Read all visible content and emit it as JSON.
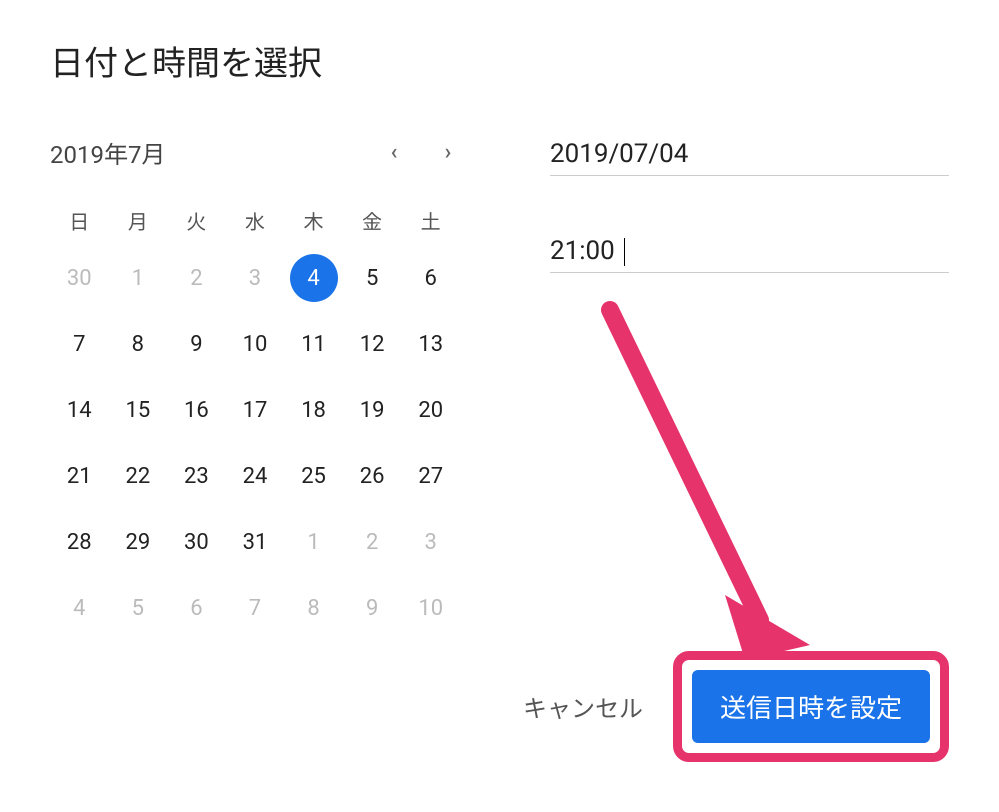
{
  "dialog": {
    "title": "日付と時間を選択"
  },
  "calendar": {
    "month_label": "2019年7月",
    "weekdays": [
      "日",
      "月",
      "火",
      "水",
      "木",
      "金",
      "土"
    ],
    "selected_day": 4,
    "weeks": [
      [
        {
          "n": 30,
          "o": true
        },
        {
          "n": 1,
          "o": true
        },
        {
          "n": 2,
          "o": true
        },
        {
          "n": 3,
          "o": true
        },
        {
          "n": 4,
          "o": false,
          "sel": true
        },
        {
          "n": 5,
          "o": false
        },
        {
          "n": 6,
          "o": false
        }
      ],
      [
        {
          "n": 7,
          "o": false
        },
        {
          "n": 8,
          "o": false
        },
        {
          "n": 9,
          "o": false
        },
        {
          "n": 10,
          "o": false
        },
        {
          "n": 11,
          "o": false
        },
        {
          "n": 12,
          "o": false
        },
        {
          "n": 13,
          "o": false
        }
      ],
      [
        {
          "n": 14,
          "o": false
        },
        {
          "n": 15,
          "o": false
        },
        {
          "n": 16,
          "o": false
        },
        {
          "n": 17,
          "o": false
        },
        {
          "n": 18,
          "o": false
        },
        {
          "n": 19,
          "o": false
        },
        {
          "n": 20,
          "o": false
        }
      ],
      [
        {
          "n": 21,
          "o": false
        },
        {
          "n": 22,
          "o": false
        },
        {
          "n": 23,
          "o": false
        },
        {
          "n": 24,
          "o": false
        },
        {
          "n": 25,
          "o": false
        },
        {
          "n": 26,
          "o": false
        },
        {
          "n": 27,
          "o": false
        }
      ],
      [
        {
          "n": 28,
          "o": false
        },
        {
          "n": 29,
          "o": false
        },
        {
          "n": 30,
          "o": false
        },
        {
          "n": 31,
          "o": false
        },
        {
          "n": 1,
          "o": true
        },
        {
          "n": 2,
          "o": true
        },
        {
          "n": 3,
          "o": true
        }
      ],
      [
        {
          "n": 4,
          "o": true
        },
        {
          "n": 5,
          "o": true
        },
        {
          "n": 6,
          "o": true
        },
        {
          "n": 7,
          "o": true
        },
        {
          "n": 8,
          "o": true
        },
        {
          "n": 9,
          "o": true
        },
        {
          "n": 10,
          "o": true
        }
      ]
    ]
  },
  "fields": {
    "date_value": "2019/07/04",
    "time_value": "21:00"
  },
  "actions": {
    "cancel_label": "キャンセル",
    "submit_label": "送信日時を設定"
  },
  "annotation": {
    "arrow_color": "#e6336b"
  }
}
